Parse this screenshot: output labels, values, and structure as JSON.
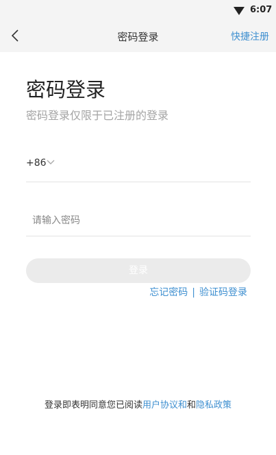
{
  "status_bar": {
    "time": "6:07",
    "wifi_icon": "wifi-icon"
  },
  "nav": {
    "title": "密码登录",
    "register": "快捷注册",
    "back_icon": "chevron-left-icon"
  },
  "header": {
    "title": "密码登录",
    "subtitle": "密码登录仅限于已注册的登录"
  },
  "phone": {
    "country_code": "+86",
    "chevron_icon": "chevron-down-icon"
  },
  "password": {
    "placeholder": "请输入密码"
  },
  "login_button": "登录",
  "links": {
    "forgot": "忘记密码",
    "separator": "|",
    "code_login": "验证码登录"
  },
  "agreement": {
    "prefix": "登录即表明同意您已阅读",
    "user_agreement": "用户协议和",
    "conjunction": "和",
    "privacy": "隐私政策"
  },
  "colors": {
    "link": "#3e8fd0",
    "button_disabled": "#ebebeb",
    "nav_background": "#f4f4f4"
  }
}
